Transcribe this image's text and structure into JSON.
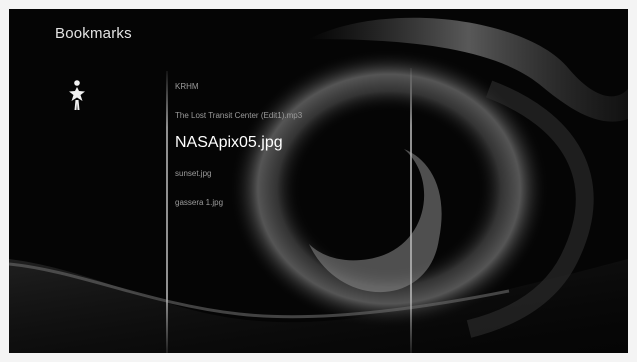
{
  "screen": {
    "title": "Bookmarks",
    "icon": "star-icon"
  },
  "bookmarks": {
    "items": [
      {
        "label": "KRHM",
        "selected": false
      },
      {
        "label": "The Lost Transit Center (Edit1).mp3",
        "selected": false
      },
      {
        "label": "NASApix05.jpg",
        "selected": true
      },
      {
        "label": "sunset.jpg",
        "selected": false
      },
      {
        "label": "gassera 1.jpg",
        "selected": false
      }
    ]
  },
  "colors": {
    "background": "#050505",
    "text_dim": "#9c9c9c",
    "text_selected": "#ffffff"
  }
}
